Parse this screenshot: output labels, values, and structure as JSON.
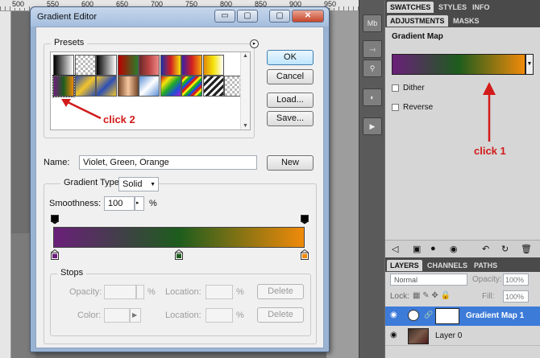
{
  "rulers": {
    "marks": [
      "500",
      "550",
      "600",
      "650",
      "700",
      "750",
      "800",
      "850",
      "900",
      "950"
    ]
  },
  "dialog": {
    "title": "Gradient Editor",
    "title_buttons": {
      "minimize": "▭",
      "maximize": "▢",
      "close": "✕"
    },
    "presets": {
      "label": "Presets",
      "menu_icon": "circle-arrow-icon",
      "swatches_row1": [
        "linear-gradient(90deg,#000,#fff)",
        "repeating-conic-gradient(#bbb 0 25%,#fff 0 50%) 0 0/6px 6px",
        "linear-gradient(90deg,#000,#fff)",
        "linear-gradient(90deg,#b00,#2a7d2a)",
        "linear-gradient(90deg,#6a2a2a,#b44,#e88)",
        "linear-gradient(90deg,#1e2fa8,#d21f1f,#f5e40c)",
        "linear-gradient(90deg,#3b1fa8,#d21f1f,#f5a40c)",
        "linear-gradient(90deg,#e08a0a,#f5e40c,#fff)"
      ],
      "swatches_row2": [
        "linear-gradient(90deg,#6b1f7a,#1d5c1d,#f08a0a)",
        "linear-gradient(135deg,#2d4fb5,#f3c42b,#2d4fb5)",
        "linear-gradient(135deg,#f3c42b,#2d4fb5,#f3c42b)",
        "linear-gradient(90deg,#7a4a2a,#f6c6a0,#7a4a2a)",
        "linear-gradient(135deg,#5a8fd6,#fff,#5a8fd6)",
        "linear-gradient(135deg,#d21f1f,#f5e40c,#1fa82a,#1e4fd6,#a81fd6)",
        "repeating-linear-gradient(135deg,#d21f1f 0 3px,#f5e40c 3px 6px,#1fa82a 6px 9px,#1e4fd6 9px 12px)",
        "repeating-linear-gradient(135deg,#222 0 3px,#fff 3px 6px)",
        "repeating-conic-gradient(#bbb 0 25%,#fff 0 50%) 0 0/6px 6px"
      ]
    },
    "buttons": {
      "ok": "OK",
      "cancel": "Cancel",
      "load": "Load...",
      "save": "Save...",
      "new": "New",
      "delete": "Delete"
    },
    "name": {
      "label": "Name:",
      "value": "Violet, Green, Orange"
    },
    "gradient_type": {
      "label": "Gradient Type:",
      "value": "Solid"
    },
    "smoothness": {
      "label": "Smoothness:",
      "value": "100",
      "unit": "%"
    },
    "gradient": {
      "colors": [
        "#6b1f7a",
        "#1d5c1d",
        "#f08a0a"
      ],
      "css": "linear-gradient(90deg,#6b1f7a 0%,#1d5c1d 50%,#f08a0a 100%)"
    },
    "stops": {
      "label": "Stops",
      "opacity_label": "Opacity:",
      "color_label": "Color:",
      "location_label": "Location:",
      "percent": "%"
    }
  },
  "annotations": {
    "click2": "click 2",
    "click1": "click 1",
    "color": "#d21a1a"
  },
  "right_panel": {
    "top_tabs": [
      "SWATCHES",
      "STYLES",
      "INFO"
    ],
    "adj_tabs": [
      "ADJUSTMENTS",
      "MASKS"
    ],
    "adjustment_title": "Gradient Map",
    "dither_label": "Dither",
    "reverse_label": "Reverse",
    "layers_tabs": [
      "LAYERS",
      "CHANNELS",
      "PATHS"
    ],
    "blend_mode": "Normal",
    "opacity_label": "Opacity:",
    "opacity_value": "100%",
    "lock_label": "Lock:",
    "fill_label": "Fill:",
    "fill_value": "100%",
    "layers": [
      {
        "name": "Gradient Map 1",
        "selected": true
      },
      {
        "name": "Layer 0",
        "selected": false
      }
    ]
  }
}
